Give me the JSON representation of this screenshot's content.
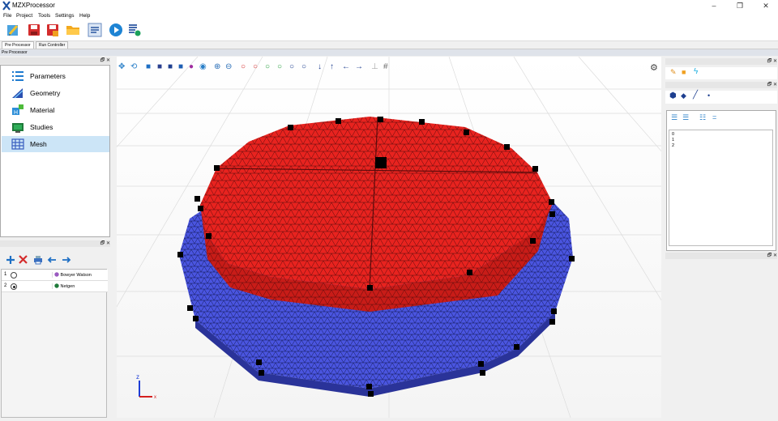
{
  "app": {
    "title": "MZXProcessor",
    "accent": "#1a6fc9"
  },
  "window_controls": {
    "minimize": "–",
    "maximize": "❐",
    "close": "✕"
  },
  "menu": [
    "File",
    "Project",
    "Tools",
    "Settings",
    "Help"
  ],
  "toolbar": [
    "edit-icon",
    "save-icon",
    "save-as-icon",
    "open-folder-icon",
    "list-icon",
    "run-icon",
    "settings-list-icon"
  ],
  "tabs": [
    {
      "label": "Pre Processor",
      "active": true
    },
    {
      "label": "Run Controller",
      "active": false
    }
  ],
  "section_header": "Pre Processor",
  "dock_controls": "🗗 ✕",
  "tree": [
    {
      "label": "Parameters",
      "icon": "parameters-icon",
      "selected": false
    },
    {
      "label": "Geometry",
      "icon": "geometry-icon",
      "selected": false
    },
    {
      "label": "Material",
      "icon": "material-icon",
      "selected": false
    },
    {
      "label": "Studies",
      "icon": "studies-icon",
      "selected": false
    },
    {
      "label": "Mesh",
      "icon": "mesh-icon",
      "selected": true
    }
  ],
  "mesh_toolbar": [
    "add-icon",
    "delete-icon",
    "print-icon",
    "import-icon",
    "export-icon"
  ],
  "mesh_table": [
    {
      "num": "1",
      "checked": false,
      "name": "Bowyer Watson"
    },
    {
      "num": "2",
      "checked": true,
      "name": "Netgen"
    }
  ],
  "viewport": {
    "axis_labels": {
      "z": "z",
      "x": "x"
    },
    "colors": {
      "top": "#e8231f",
      "ring": "#4a55e0",
      "node": "#000000"
    }
  },
  "right_panel": {
    "list_items": [
      "0",
      "1",
      "2"
    ]
  }
}
